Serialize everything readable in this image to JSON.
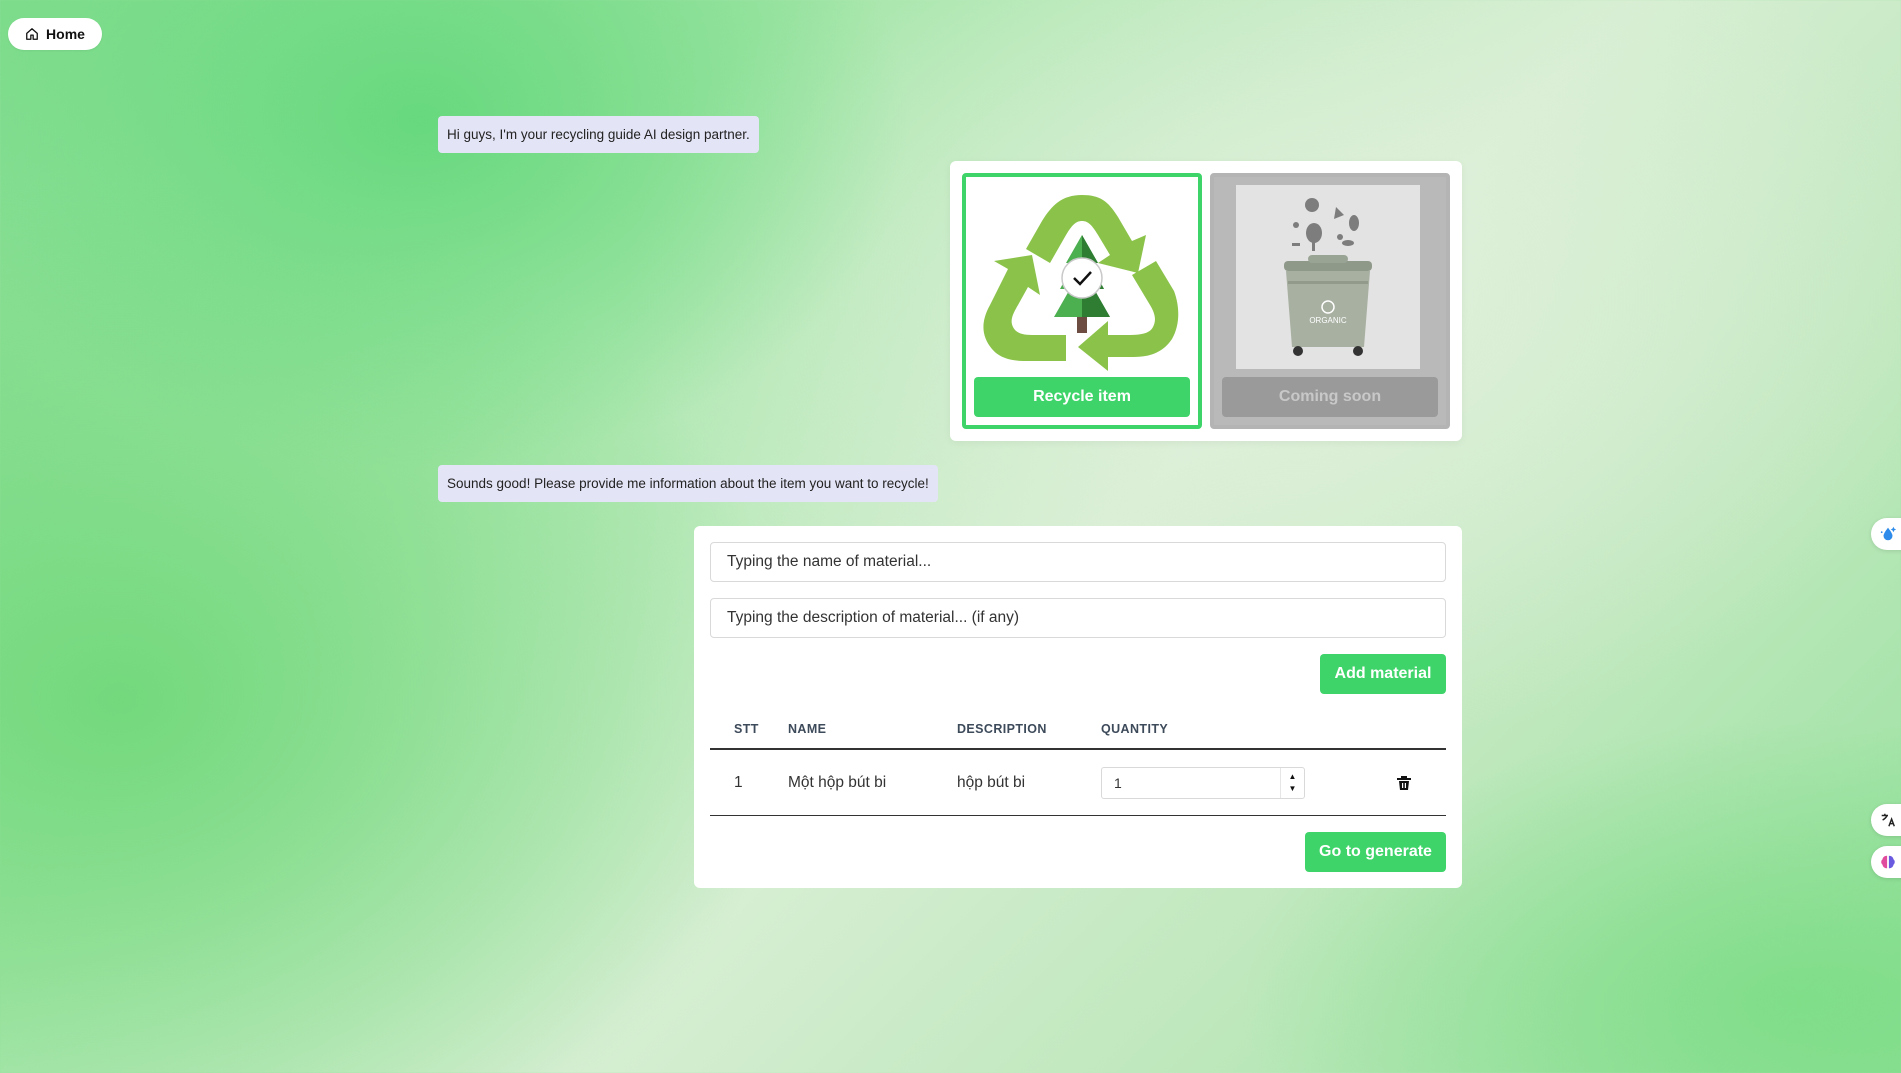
{
  "nav": {
    "home_label": "Home"
  },
  "chat": {
    "greeting": "Hi guys, I'm your recycling guide AI design partner.",
    "prompt": "Sounds good! Please provide me information about the item you want to recycle!"
  },
  "options": {
    "recycle": {
      "label": "Recycle item",
      "image": "recycle-tree-icon",
      "selected": true
    },
    "coming_soon": {
      "label": "Coming soon",
      "image": "organic-bin-icon",
      "bin_text": "ORGANIC"
    }
  },
  "form": {
    "name_placeholder": "Typing the name of material...",
    "description_placeholder": "Typing the description of material... (if any)",
    "add_button": "Add material",
    "generate_button": "Go to generate"
  },
  "table": {
    "headers": [
      "STT",
      "NAME",
      "DESCRIPTION",
      "QUANTITY"
    ],
    "rows": [
      {
        "stt": "1",
        "name": "Một hộp bút bi",
        "description": "hộp bút bi",
        "quantity": "1"
      }
    ]
  },
  "colors": {
    "accent": "#3fd46a",
    "bubble": "#e4e4f7",
    "disabled": "#9a9a9a"
  }
}
